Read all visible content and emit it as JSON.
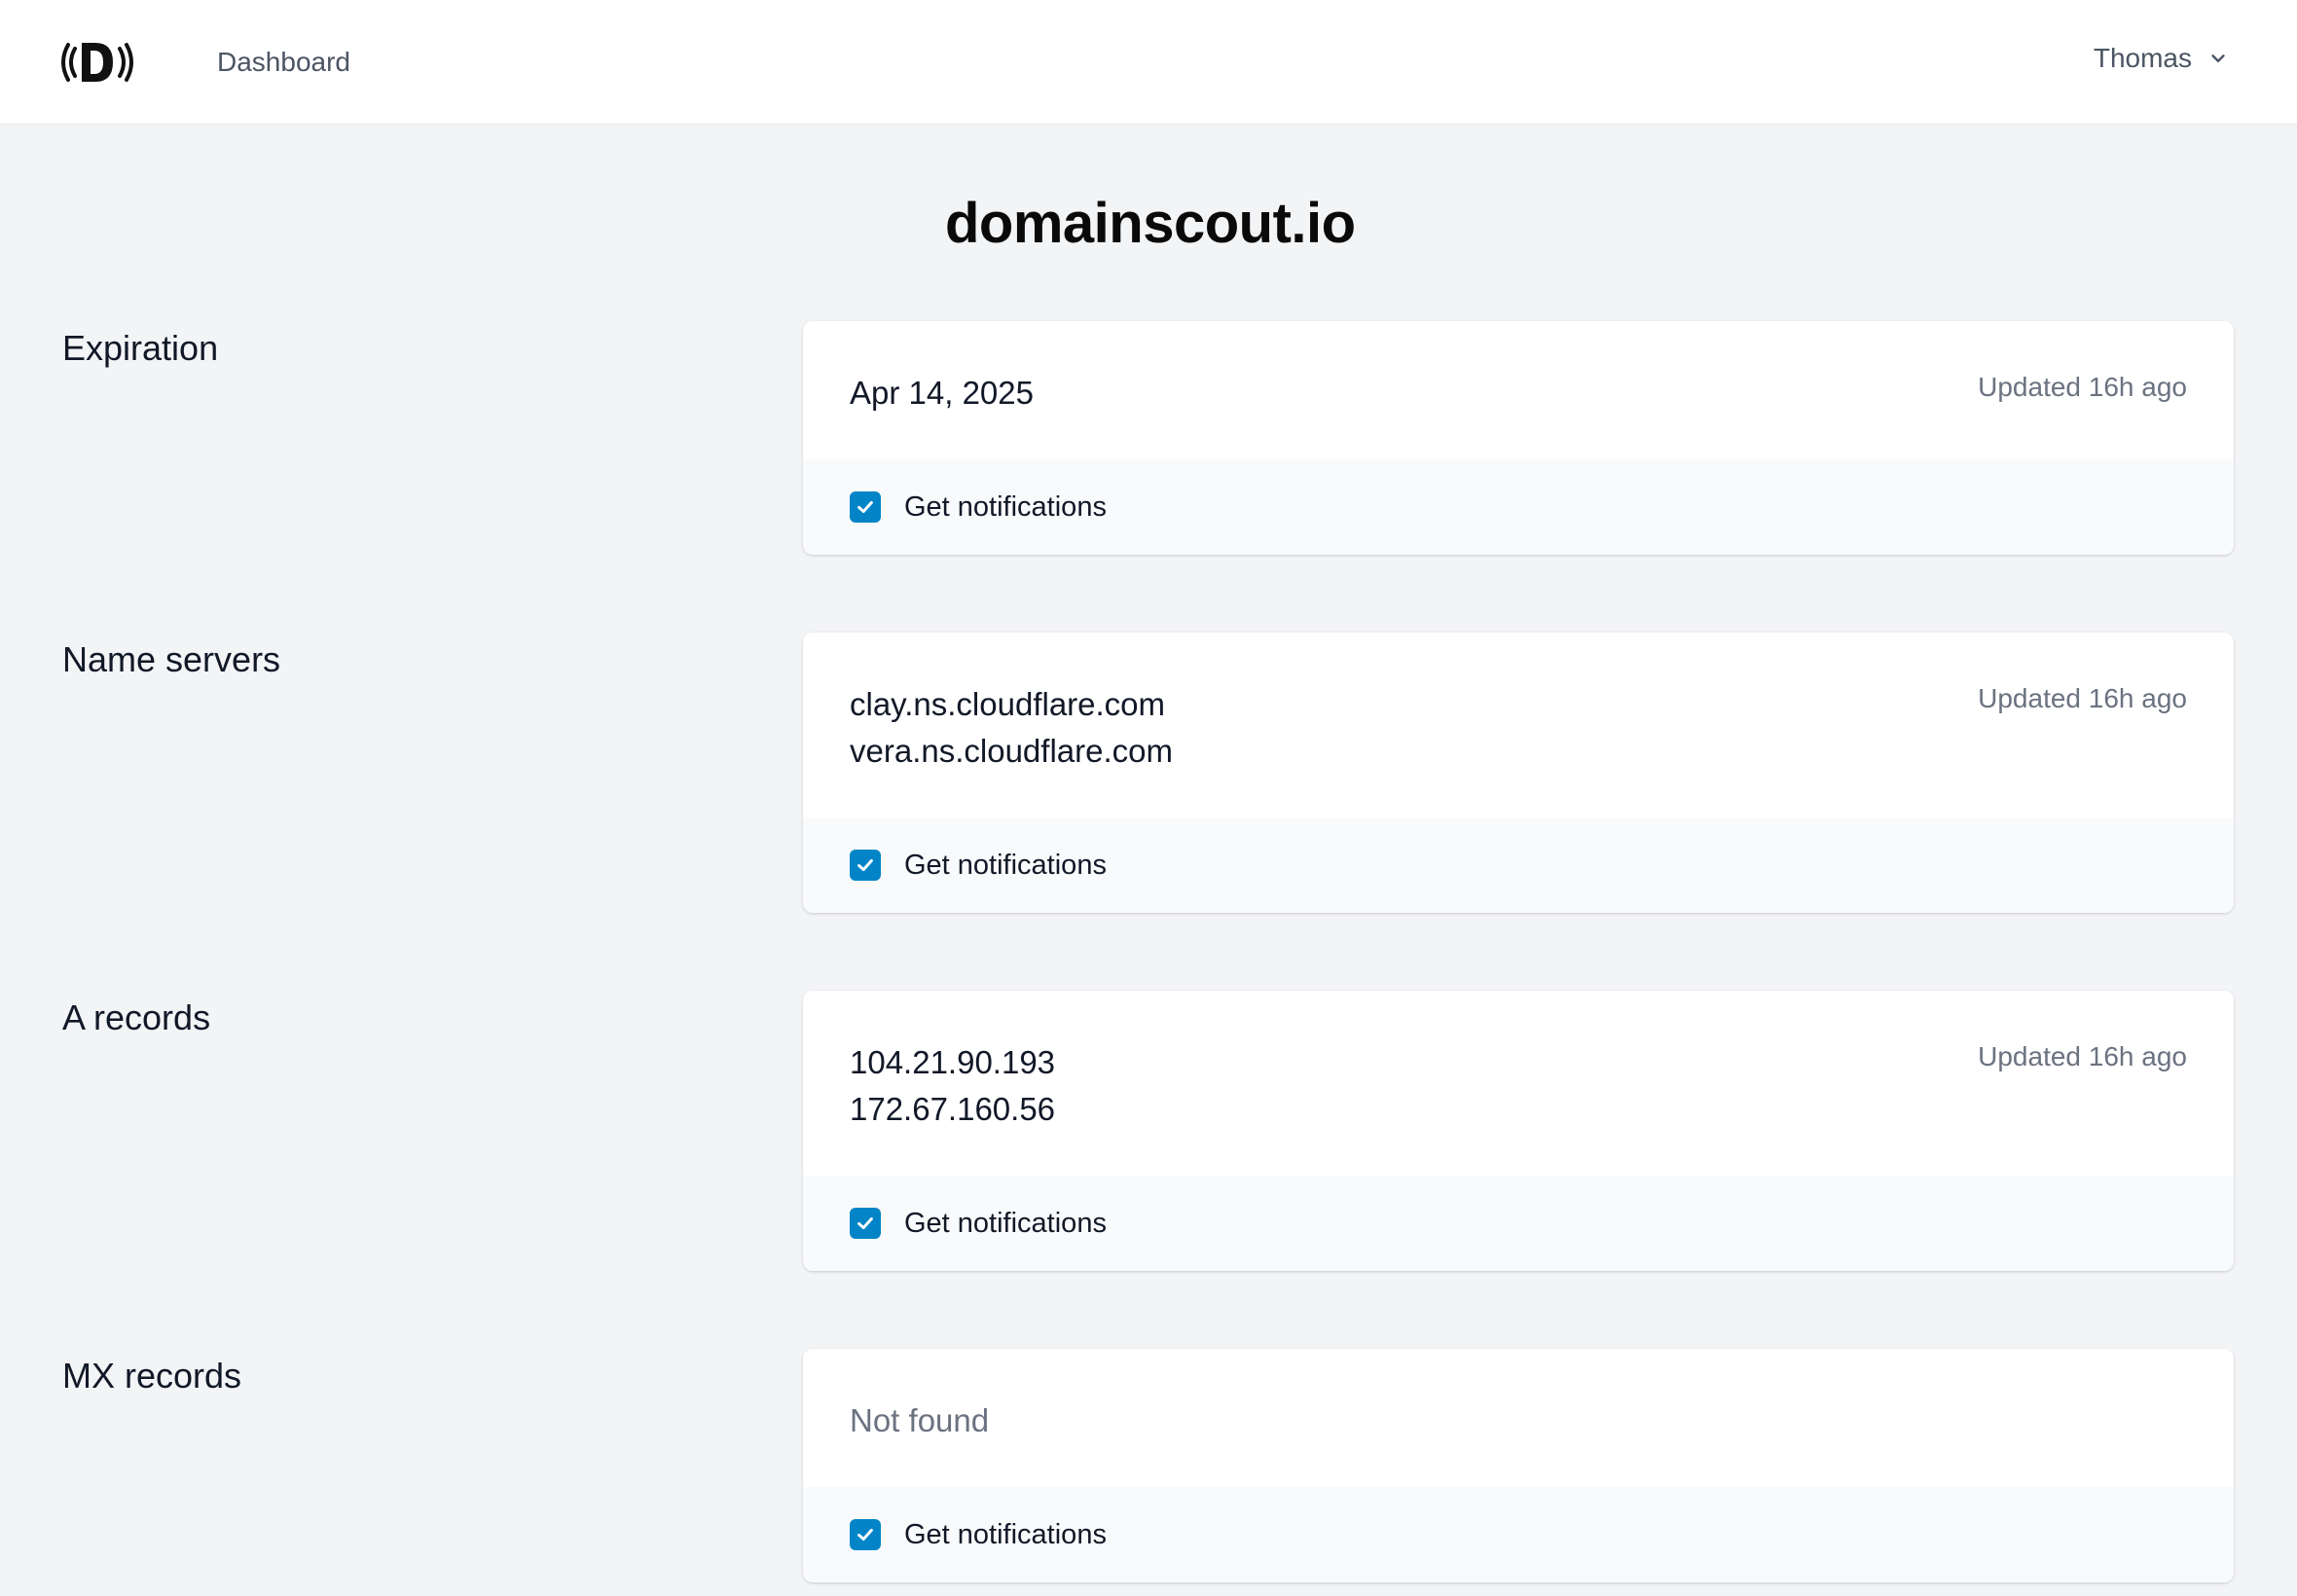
{
  "header": {
    "nav_dashboard": "Dashboard",
    "user_name": "Thomas"
  },
  "domain": {
    "name": "domainscout.io"
  },
  "sections": {
    "expiration": {
      "label": "Expiration",
      "values": [
        "Apr 14, 2025"
      ],
      "updated": "Updated 16h ago",
      "notification_label": "Get notifications",
      "notifications_enabled": true
    },
    "name_servers": {
      "label": "Name servers",
      "values": [
        "clay.ns.cloudflare.com",
        "vera.ns.cloudflare.com"
      ],
      "updated": "Updated 16h ago",
      "notification_label": "Get notifications",
      "notifications_enabled": true
    },
    "a_records": {
      "label": "A records",
      "values": [
        "104.21.90.193",
        "172.67.160.56"
      ],
      "updated": "Updated 16h ago",
      "notification_label": "Get notifications",
      "notifications_enabled": true
    },
    "mx_records": {
      "label": "MX records",
      "values": [
        "Not found"
      ],
      "notification_label": "Get notifications",
      "notifications_enabled": true
    }
  },
  "colors": {
    "accent": "#0284c7",
    "background": "#f3f4f6",
    "card": "#ffffff",
    "card_footer": "#f9fafb",
    "muted_text": "#6b7280"
  }
}
